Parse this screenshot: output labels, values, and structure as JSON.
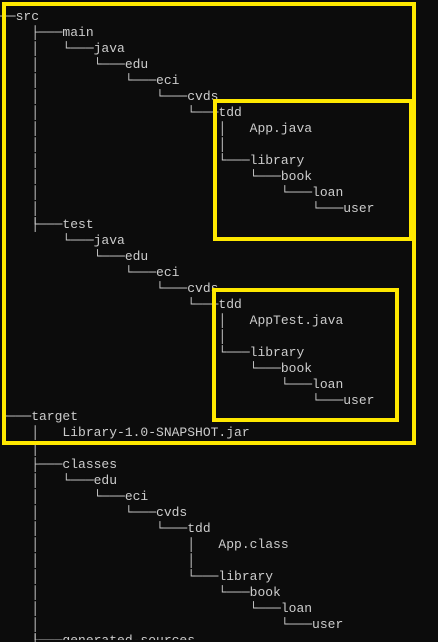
{
  "tree_lines": [
    "──src",
    "    ├───main",
    "    │   └───java",
    "    │       └───edu",
    "    │           └───eci",
    "    │               └───cvds",
    "    │                   └───tdd",
    "    │                       │   App.java",
    "    │                       │",
    "    │                       └───library",
    "    │                           └───book",
    "    │                               └───loan",
    "    │                                   └───user",
    "    │",
    "    └───test",
    "        └───java",
    "            └───edu",
    "                └───eci",
    "                    └───cvds",
    "                        └───tdd",
    "                            │   AppTest.java",
    "                            │",
    "                            └───library",
    "                                └───book",
    "                                    └───loan",
    "                                        └───user",
    "└───target",
    "    │   Library-1.0-SNAPSHOT.jar",
    "    │",
    "    ├───classes",
    "    │   └───edu",
    "    │       └───eci",
    "    │           └───cvds",
    "    │               └───tdd",
    "    │                   │   App.class",
    "    │                   │",
    "    │                   └───library",
    "    │                       └───book",
    "    │                           └───loan",
    "    │                               └───user",
    "    │",
    "    ├───generated-sources"
  ],
  "colors": {
    "background": "#0c0c0c",
    "text": "#cccccc",
    "highlight": "#ffe800"
  }
}
